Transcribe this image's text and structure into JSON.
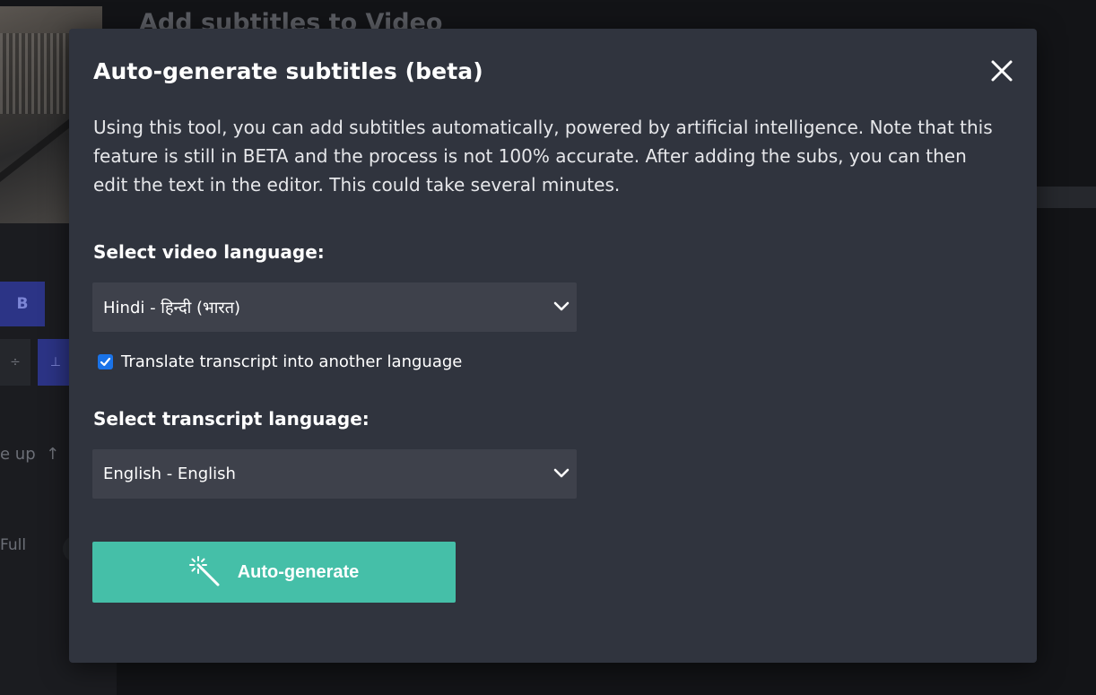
{
  "background": {
    "page_title": "Add subtitles to Video",
    "bold_button": "B",
    "move_up_label": "e up",
    "full_label": "Full"
  },
  "modal": {
    "title": "Auto-generate subtitles (beta)",
    "description": "Using this tool, you can add subtitles automatically, powered by artificial intelligence. Note that this feature is still in BETA and the process is not 100% accurate. After adding the subs, you can then edit the text in the editor. This could take several minutes.",
    "video_language": {
      "label": "Select video language:",
      "selected": "Hindi - हिन्दी (भारत)"
    },
    "translate_checkbox": {
      "label": "Translate transcript into another language",
      "checked": true
    },
    "transcript_language": {
      "label": "Select transcript language:",
      "selected": "English - English"
    },
    "generate_button": {
      "label": "Auto-generate",
      "icon": "magic-wand-icon"
    },
    "close_icon": "close-icon"
  },
  "colors": {
    "modal_bg": "#30343e",
    "select_bg": "#3e414b",
    "button_accent": "#45bfa8",
    "checkbox_accent": "#1a73e8"
  }
}
